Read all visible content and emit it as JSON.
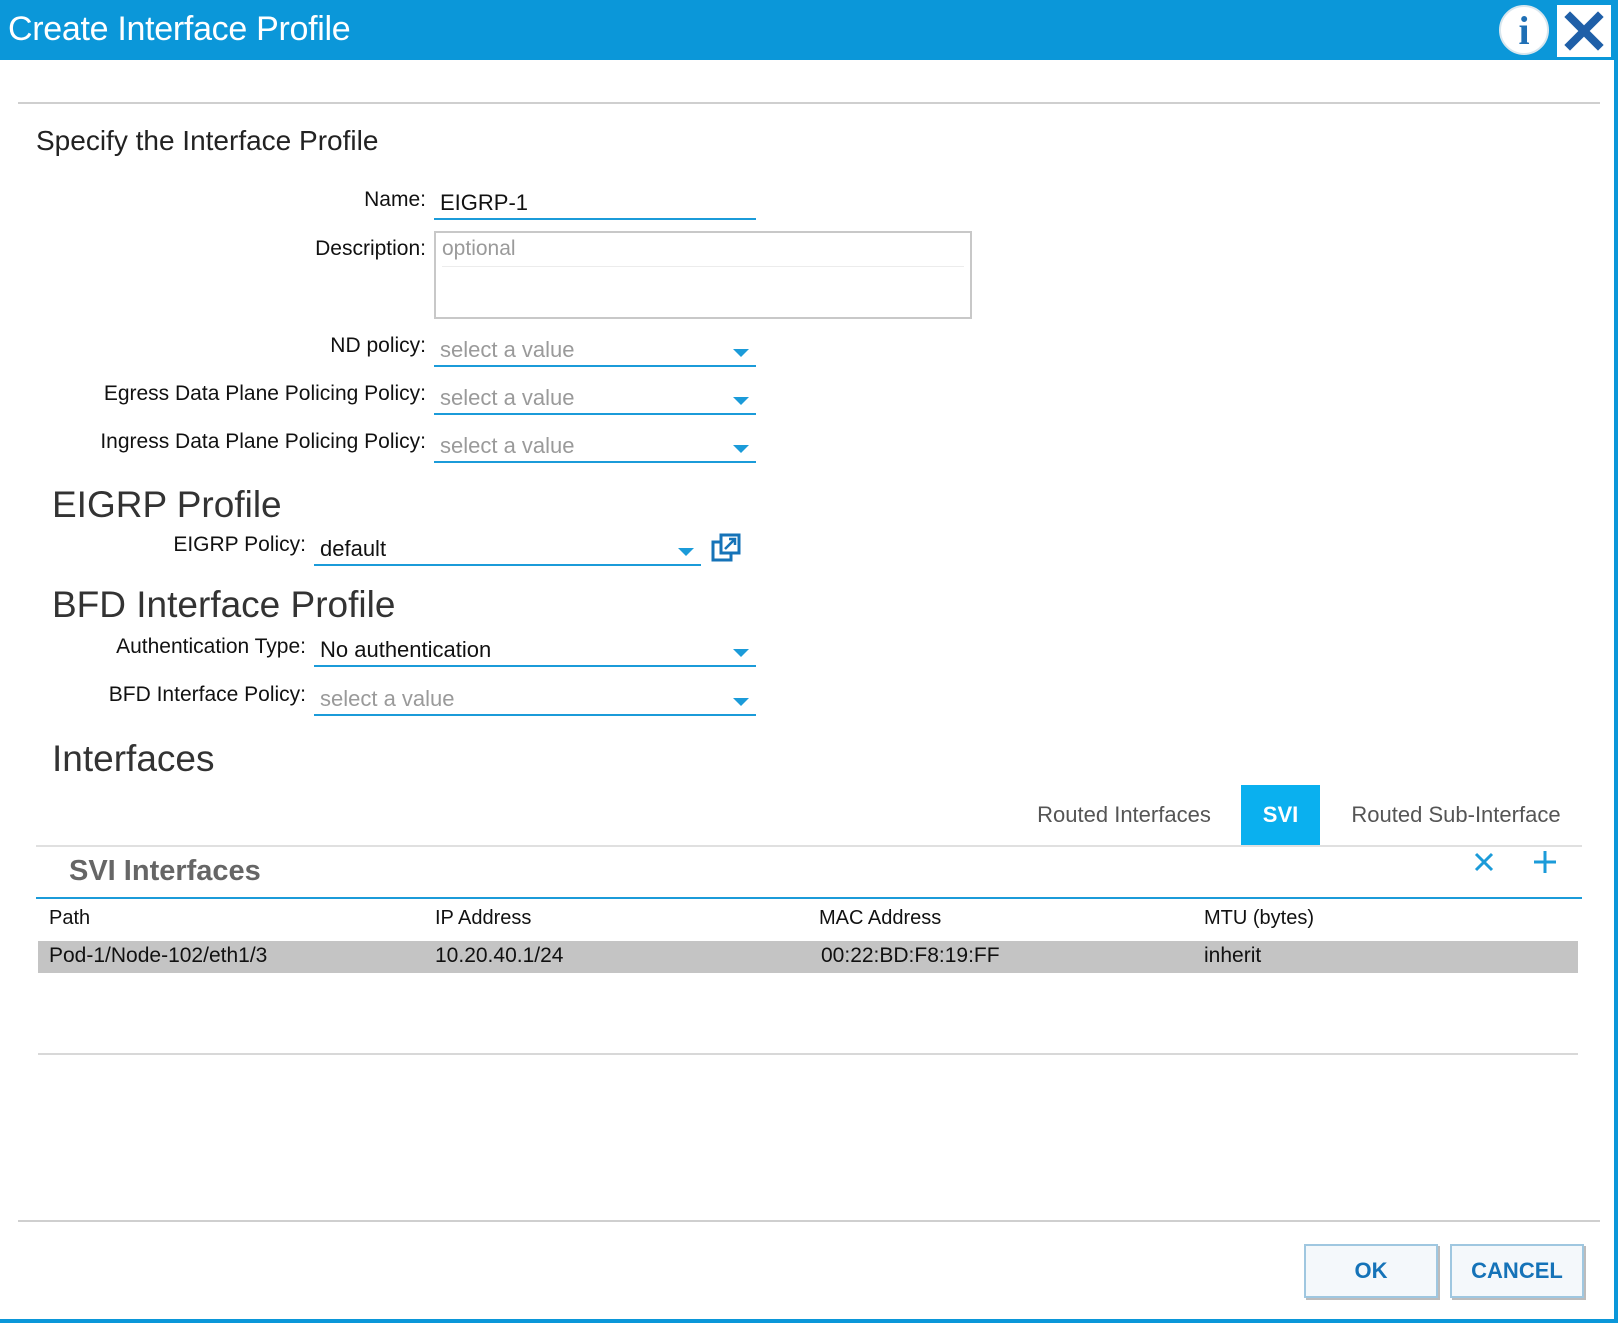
{
  "dialog": {
    "title": "Create Interface Profile",
    "info_glyph": "i"
  },
  "form": {
    "section_title": "Specify the Interface Profile",
    "name": {
      "label": "Name:",
      "value": "EIGRP-1"
    },
    "description": {
      "label": "Description:",
      "placeholder": "optional"
    },
    "nd_policy": {
      "label": "ND policy:",
      "placeholder": "select a value"
    },
    "egress_policy": {
      "label": "Egress Data Plane Policing Policy:",
      "placeholder": "select a value"
    },
    "ingress_policy": {
      "label": "Ingress Data Plane Policing Policy:",
      "placeholder": "select a value"
    }
  },
  "eigrp": {
    "section_title": "EIGRP Profile",
    "policy": {
      "label": "EIGRP Policy:",
      "value": "default"
    }
  },
  "bfd": {
    "section_title": "BFD Interface Profile",
    "auth_type": {
      "label": "Authentication Type:",
      "value": "No authentication"
    },
    "interface_policy": {
      "label": "BFD Interface Policy:",
      "placeholder": "select a value"
    }
  },
  "interfaces": {
    "section_title": "Interfaces",
    "tabs": [
      {
        "label": "Routed Interfaces",
        "active": false
      },
      {
        "label": "SVI",
        "active": true
      },
      {
        "label": "Routed Sub-Interface",
        "active": false
      }
    ],
    "table_title": "SVI Interfaces",
    "columns": [
      "Path",
      "IP Address",
      "MAC Address",
      "MTU (bytes)"
    ],
    "rows": [
      [
        "Pod-1/Node-102/eth1/3",
        "10.20.40.1/24",
        "00:22:BD:F8:19:FF",
        "inherit"
      ]
    ]
  },
  "footer": {
    "ok_label": "OK",
    "cancel_label": "CANCEL"
  },
  "colors": {
    "accent": "#0b97d9",
    "tab_active": "#0ab0ef",
    "row_selected": "#c4c4c4"
  }
}
